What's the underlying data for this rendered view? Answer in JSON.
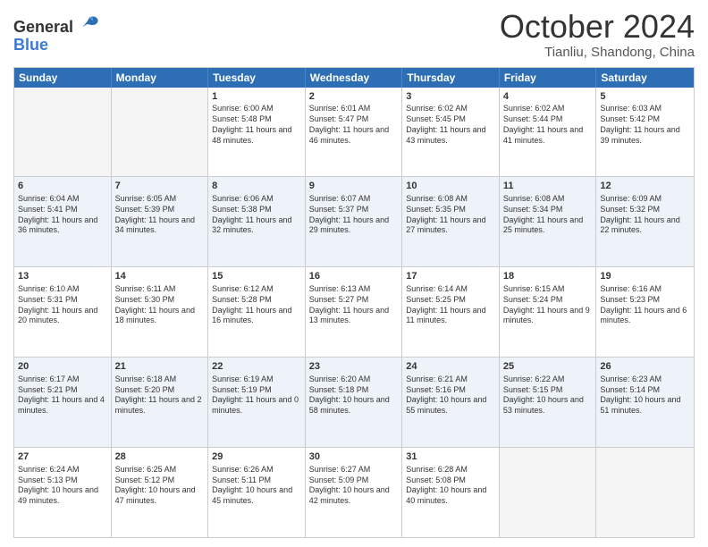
{
  "logo": {
    "general": "General",
    "blue": "Blue"
  },
  "title": "October 2024",
  "location": "Tianliu, Shandong, China",
  "weekdays": [
    "Sunday",
    "Monday",
    "Tuesday",
    "Wednesday",
    "Thursday",
    "Friday",
    "Saturday"
  ],
  "rows": [
    [
      {
        "day": "",
        "sunrise": "",
        "sunset": "",
        "daylight": "",
        "empty": true
      },
      {
        "day": "",
        "sunrise": "",
        "sunset": "",
        "daylight": "",
        "empty": true
      },
      {
        "day": "1",
        "sunrise": "Sunrise: 6:00 AM",
        "sunset": "Sunset: 5:48 PM",
        "daylight": "Daylight: 11 hours and 48 minutes."
      },
      {
        "day": "2",
        "sunrise": "Sunrise: 6:01 AM",
        "sunset": "Sunset: 5:47 PM",
        "daylight": "Daylight: 11 hours and 46 minutes."
      },
      {
        "day": "3",
        "sunrise": "Sunrise: 6:02 AM",
        "sunset": "Sunset: 5:45 PM",
        "daylight": "Daylight: 11 hours and 43 minutes."
      },
      {
        "day": "4",
        "sunrise": "Sunrise: 6:02 AM",
        "sunset": "Sunset: 5:44 PM",
        "daylight": "Daylight: 11 hours and 41 minutes."
      },
      {
        "day": "5",
        "sunrise": "Sunrise: 6:03 AM",
        "sunset": "Sunset: 5:42 PM",
        "daylight": "Daylight: 11 hours and 39 minutes."
      }
    ],
    [
      {
        "day": "6",
        "sunrise": "Sunrise: 6:04 AM",
        "sunset": "Sunset: 5:41 PM",
        "daylight": "Daylight: 11 hours and 36 minutes."
      },
      {
        "day": "7",
        "sunrise": "Sunrise: 6:05 AM",
        "sunset": "Sunset: 5:39 PM",
        "daylight": "Daylight: 11 hours and 34 minutes."
      },
      {
        "day": "8",
        "sunrise": "Sunrise: 6:06 AM",
        "sunset": "Sunset: 5:38 PM",
        "daylight": "Daylight: 11 hours and 32 minutes."
      },
      {
        "day": "9",
        "sunrise": "Sunrise: 6:07 AM",
        "sunset": "Sunset: 5:37 PM",
        "daylight": "Daylight: 11 hours and 29 minutes."
      },
      {
        "day": "10",
        "sunrise": "Sunrise: 6:08 AM",
        "sunset": "Sunset: 5:35 PM",
        "daylight": "Daylight: 11 hours and 27 minutes."
      },
      {
        "day": "11",
        "sunrise": "Sunrise: 6:08 AM",
        "sunset": "Sunset: 5:34 PM",
        "daylight": "Daylight: 11 hours and 25 minutes."
      },
      {
        "day": "12",
        "sunrise": "Sunrise: 6:09 AM",
        "sunset": "Sunset: 5:32 PM",
        "daylight": "Daylight: 11 hours and 22 minutes."
      }
    ],
    [
      {
        "day": "13",
        "sunrise": "Sunrise: 6:10 AM",
        "sunset": "Sunset: 5:31 PM",
        "daylight": "Daylight: 11 hours and 20 minutes."
      },
      {
        "day": "14",
        "sunrise": "Sunrise: 6:11 AM",
        "sunset": "Sunset: 5:30 PM",
        "daylight": "Daylight: 11 hours and 18 minutes."
      },
      {
        "day": "15",
        "sunrise": "Sunrise: 6:12 AM",
        "sunset": "Sunset: 5:28 PM",
        "daylight": "Daylight: 11 hours and 16 minutes."
      },
      {
        "day": "16",
        "sunrise": "Sunrise: 6:13 AM",
        "sunset": "Sunset: 5:27 PM",
        "daylight": "Daylight: 11 hours and 13 minutes."
      },
      {
        "day": "17",
        "sunrise": "Sunrise: 6:14 AM",
        "sunset": "Sunset: 5:25 PM",
        "daylight": "Daylight: 11 hours and 11 minutes."
      },
      {
        "day": "18",
        "sunrise": "Sunrise: 6:15 AM",
        "sunset": "Sunset: 5:24 PM",
        "daylight": "Daylight: 11 hours and 9 minutes."
      },
      {
        "day": "19",
        "sunrise": "Sunrise: 6:16 AM",
        "sunset": "Sunset: 5:23 PM",
        "daylight": "Daylight: 11 hours and 6 minutes."
      }
    ],
    [
      {
        "day": "20",
        "sunrise": "Sunrise: 6:17 AM",
        "sunset": "Sunset: 5:21 PM",
        "daylight": "Daylight: 11 hours and 4 minutes."
      },
      {
        "day": "21",
        "sunrise": "Sunrise: 6:18 AM",
        "sunset": "Sunset: 5:20 PM",
        "daylight": "Daylight: 11 hours and 2 minutes."
      },
      {
        "day": "22",
        "sunrise": "Sunrise: 6:19 AM",
        "sunset": "Sunset: 5:19 PM",
        "daylight": "Daylight: 11 hours and 0 minutes."
      },
      {
        "day": "23",
        "sunrise": "Sunrise: 6:20 AM",
        "sunset": "Sunset: 5:18 PM",
        "daylight": "Daylight: 10 hours and 58 minutes."
      },
      {
        "day": "24",
        "sunrise": "Sunrise: 6:21 AM",
        "sunset": "Sunset: 5:16 PM",
        "daylight": "Daylight: 10 hours and 55 minutes."
      },
      {
        "day": "25",
        "sunrise": "Sunrise: 6:22 AM",
        "sunset": "Sunset: 5:15 PM",
        "daylight": "Daylight: 10 hours and 53 minutes."
      },
      {
        "day": "26",
        "sunrise": "Sunrise: 6:23 AM",
        "sunset": "Sunset: 5:14 PM",
        "daylight": "Daylight: 10 hours and 51 minutes."
      }
    ],
    [
      {
        "day": "27",
        "sunrise": "Sunrise: 6:24 AM",
        "sunset": "Sunset: 5:13 PM",
        "daylight": "Daylight: 10 hours and 49 minutes."
      },
      {
        "day": "28",
        "sunrise": "Sunrise: 6:25 AM",
        "sunset": "Sunset: 5:12 PM",
        "daylight": "Daylight: 10 hours and 47 minutes."
      },
      {
        "day": "29",
        "sunrise": "Sunrise: 6:26 AM",
        "sunset": "Sunset: 5:11 PM",
        "daylight": "Daylight: 10 hours and 45 minutes."
      },
      {
        "day": "30",
        "sunrise": "Sunrise: 6:27 AM",
        "sunset": "Sunset: 5:09 PM",
        "daylight": "Daylight: 10 hours and 42 minutes."
      },
      {
        "day": "31",
        "sunrise": "Sunrise: 6:28 AM",
        "sunset": "Sunset: 5:08 PM",
        "daylight": "Daylight: 10 hours and 40 minutes."
      },
      {
        "day": "",
        "sunrise": "",
        "sunset": "",
        "daylight": "",
        "empty": true
      },
      {
        "day": "",
        "sunrise": "",
        "sunset": "",
        "daylight": "",
        "empty": true
      }
    ]
  ]
}
